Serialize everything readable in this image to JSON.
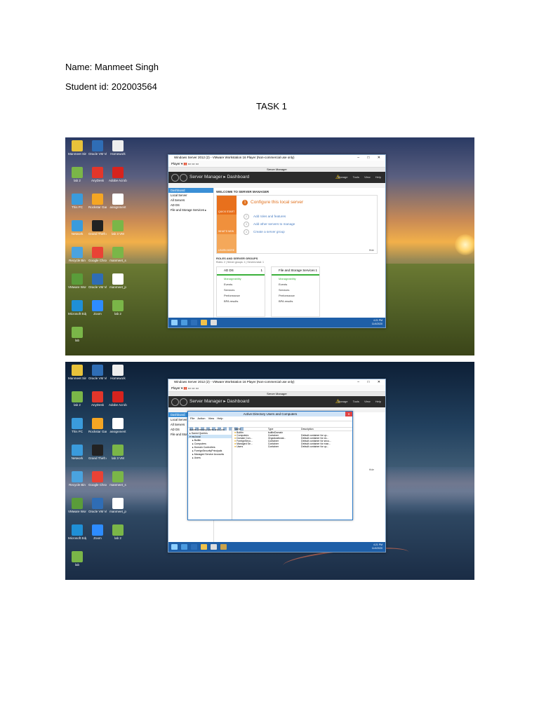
{
  "document": {
    "name_line": "Name: Manmeet Singh",
    "student_line": "Student id: 202003564",
    "task_heading": "TASK 1"
  },
  "desktop_icons": [
    {
      "label": "Manmeet Singh",
      "icon": "user-folder-icon",
      "color": "#e8c23a"
    },
    {
      "label": "Oracle VM VirtualBox",
      "icon": "virtualbox-icon",
      "color": "#2f6db5"
    },
    {
      "label": "Homework",
      "icon": "document-icon",
      "color": "#eeeeee"
    },
    {
      "label": "lab 2",
      "icon": "vmware-icon",
      "color": "#7ab648"
    },
    {
      "label": "AnyDesk",
      "icon": "anydesk-icon",
      "color": "#e2362b"
    },
    {
      "label": "Adobe Acrobat",
      "icon": "acrobat-icon",
      "color": "#d7231e"
    },
    {
      "label": "This PC",
      "icon": "computer-icon",
      "color": "#3a9bdc"
    },
    {
      "label": "Rockstar Games",
      "icon": "rockstar-icon",
      "color": "#f5a623"
    },
    {
      "label": "assignment",
      "icon": "document-icon",
      "color": "#ffffff"
    },
    {
      "label": "Network",
      "icon": "network-icon",
      "color": "#3a9bdc"
    },
    {
      "label": "Grand Theft Auto V",
      "icon": "gta-icon",
      "color": "#222222"
    },
    {
      "label": "lab 3 VM",
      "icon": "vmware-icon",
      "color": "#7ab648"
    },
    {
      "label": "Recycle Bin",
      "icon": "recycle-bin-icon",
      "color": "#4aa3df"
    },
    {
      "label": "Google Chrome",
      "icon": "chrome-icon",
      "color": "#e94235"
    },
    {
      "label": "manmeet_s",
      "icon": "vmware-icon",
      "color": "#7ab648"
    },
    {
      "label": "VMware Workstation 16 Player",
      "icon": "vmware-player-icon",
      "color": "#5a9c3a"
    },
    {
      "label": "Oracle VM VirtualBox",
      "icon": "virtualbox-icon",
      "color": "#2f6db5"
    },
    {
      "label": "manmeet_p",
      "icon": "document-icon",
      "color": "#ffffff"
    },
    {
      "label": "Microsoft Edge",
      "icon": "edge-icon",
      "color": "#1f8fd6"
    },
    {
      "label": "Zoom",
      "icon": "zoom-icon",
      "color": "#2d8cff"
    },
    {
      "label": "lab 2",
      "icon": "vmware-icon",
      "color": "#7ab648"
    },
    {
      "label": "lab",
      "icon": "vmware-icon",
      "color": "#7ab648"
    }
  ],
  "vm": {
    "window_title": "Windows Server 2012 (2) - VMware Workstation 16 Player (Non-commercial use only)",
    "player_menu": "Player ▾",
    "server_manager_title": "Server Manager",
    "breadcrumb": "Server Manager ▸ Dashboard",
    "header_menus": [
      "Manage",
      "Tools",
      "View",
      "Help"
    ],
    "left_nav": [
      "Dashboard",
      "Local Server",
      "All Servers",
      "AD DS",
      "File and Storage Services ▸"
    ],
    "welcome": "WELCOME TO SERVER MANAGER",
    "quick_start": [
      "QUICK START",
      "WHAT'S NEW",
      "LEARN MORE"
    ],
    "configure": {
      "number": "1",
      "text": "Configure this local server"
    },
    "steps": [
      {
        "number": "2",
        "text": "Add roles and features"
      },
      {
        "number": "3",
        "text": "Add other servers to manage"
      },
      {
        "number": "4",
        "text": "Create a server group"
      }
    ],
    "hide": "Hide",
    "roles_heading": "ROLES AND SERVER GROUPS",
    "roles_sub": "Roles: 2 | Server groups: 1 | Servers total: 1",
    "tiles": [
      {
        "title": "AD DS",
        "count": "1",
        "rows": [
          "Manageability",
          "Events",
          "Services",
          "Performance",
          "BPA results"
        ]
      },
      {
        "title": "File and Storage Services",
        "count": "1",
        "rows": [
          "Manageability",
          "Events",
          "Services",
          "Performance",
          "BPA results"
        ]
      }
    ],
    "clock": [
      "4:21 PM",
      "11/4/2020"
    ]
  },
  "aduc": {
    "title": "Active Directory Users and Computers",
    "menu": [
      "File",
      "Action",
      "View",
      "Help"
    ],
    "tree": [
      "Active Directory Users and Com",
      "▸ Saved Queries",
      "▾ ms.local",
      "▸ Builtin",
      "▸ Computers",
      "▸ Domain Controllers",
      "▸ ForeignSecurityPrincipals",
      "▸ Managed Service Accounts",
      "▸ Users"
    ],
    "columns": [
      "Name",
      "Type",
      "Description"
    ],
    "rows": [
      [
        "Builtin",
        "builtinDomain",
        ""
      ],
      [
        "Computers",
        "Container",
        "Default container for up..."
      ],
      [
        "Domain Con...",
        "Organizational...",
        "Default container for do..."
      ],
      [
        "ForeignSecu...",
        "Container",
        "Default container for secu..."
      ],
      [
        "Managed Se...",
        "Container",
        "Default container for man..."
      ],
      [
        "Users",
        "Container",
        "Default container for up..."
      ]
    ]
  }
}
